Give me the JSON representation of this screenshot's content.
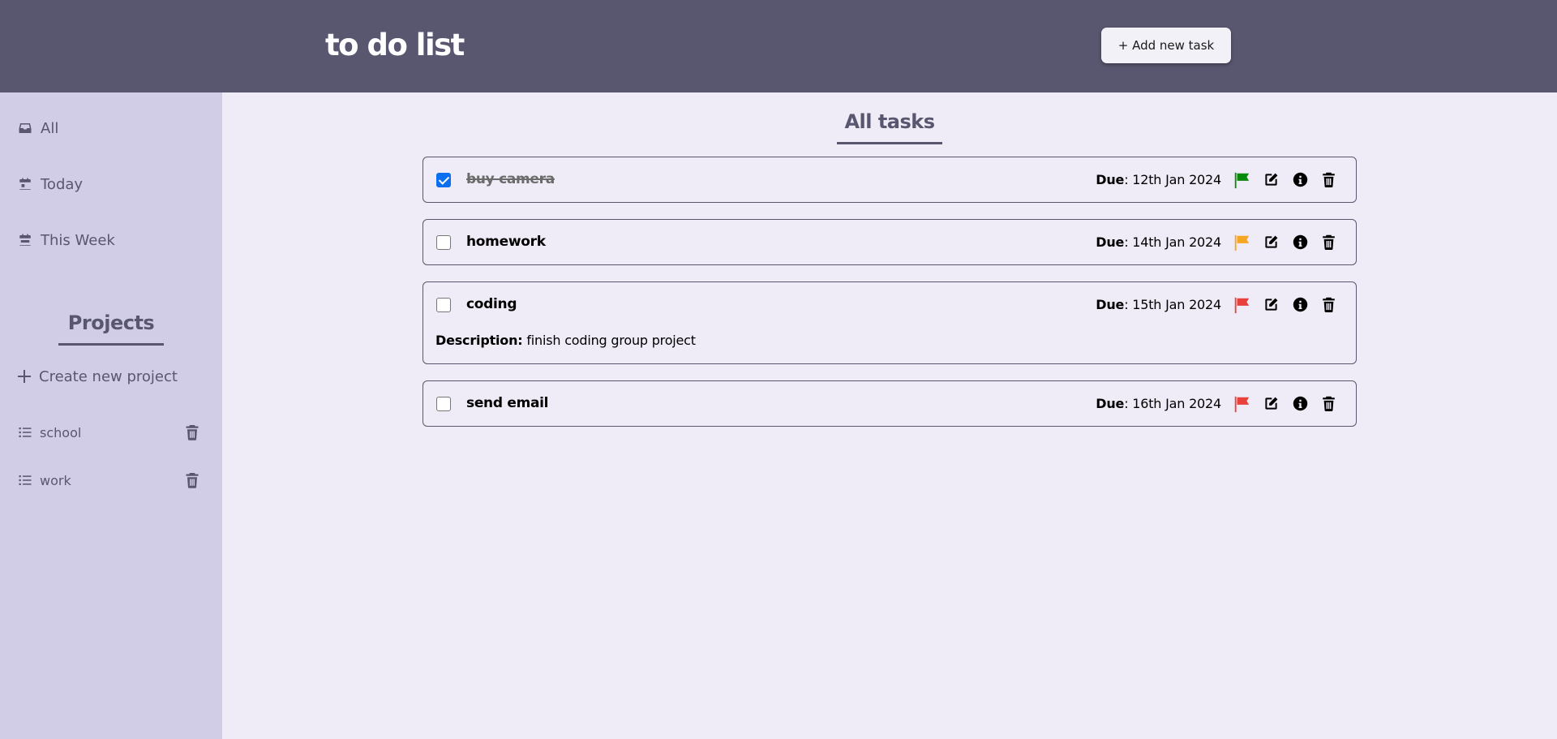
{
  "header": {
    "title": "to do list",
    "add_task_label": "+ Add new task"
  },
  "sidebar": {
    "nav": [
      {
        "label": "All",
        "icon": "inbox-icon"
      },
      {
        "label": "Today",
        "icon": "calendar-icon"
      },
      {
        "label": "This Week",
        "icon": "calendar-week-icon"
      }
    ],
    "projects_title": "Projects",
    "create_project_label": "Create new project",
    "projects": [
      {
        "name": "school"
      },
      {
        "name": "work"
      }
    ]
  },
  "main": {
    "title": "All tasks",
    "due_label": "Due",
    "description_label": "Description:",
    "tasks": [
      {
        "name": "buy camera",
        "due": ": 12th Jan 2024",
        "checked": true,
        "priority_color": "#0a8a0a",
        "description": ""
      },
      {
        "name": "homework",
        "due": ": 14th Jan 2024",
        "checked": false,
        "priority_color": "#f5a623",
        "description": ""
      },
      {
        "name": "coding",
        "due": ": 15th Jan 2024",
        "checked": false,
        "priority_color": "#e8413c",
        "description": " finish coding group project"
      },
      {
        "name": "send email",
        "due": ": 16th Jan 2024",
        "checked": false,
        "priority_color": "#e8413c",
        "description": ""
      }
    ]
  },
  "colors": {
    "header_bg": "#59566f",
    "sidebar_bg": "#d1cde6",
    "main_bg": "#efecf7",
    "accent": "#59566f",
    "checkbox_checked": "#0b6ff0"
  }
}
